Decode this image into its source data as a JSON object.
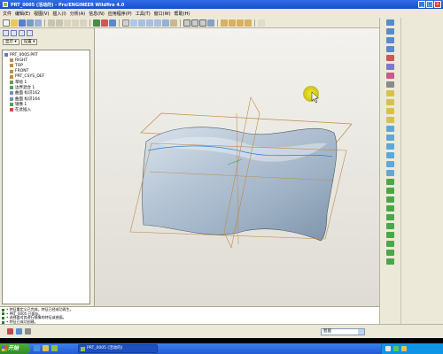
{
  "window": {
    "title": "PRT_0005 (活动的) - Pro/ENGINEER Wildfire 4.0",
    "buttons": [
      "_",
      "□",
      "×"
    ]
  },
  "menu": [
    "文件",
    "编辑(E)",
    "视图(V)",
    "插入(I)",
    "分析(A)",
    "信息(N)",
    "应用程序(P)",
    "工具(T)",
    "窗口(W)",
    "帮助(H)"
  ],
  "nav": {
    "tabs": [
      "显示",
      "设置"
    ],
    "tree": [
      {
        "label": "PRT_0005.PRT",
        "child": false
      },
      {
        "label": "RIGHT",
        "child": true
      },
      {
        "label": "TOP",
        "child": true
      },
      {
        "label": "FRONT",
        "child": true
      },
      {
        "label": "PRT_CSYS_DEF",
        "child": true
      },
      {
        "label": "草绘 1",
        "child": true
      },
      {
        "label": "边界混合 1",
        "child": true
      },
      {
        "label": "曲面 标识162",
        "child": true
      },
      {
        "label": "曲面 标识164",
        "child": true
      },
      {
        "label": "镜像 1",
        "child": true
      },
      {
        "label": "在此插入",
        "child": true
      }
    ]
  },
  "messages": [
    "•  特征重定义已完成，特征已经成功再生。",
    "•  PRT_0005 已保存。",
    "•  选择要对其进行镜像的特征或曲面。",
    "•  特征已成功创建。"
  ],
  "status": {
    "filter_value": "智能"
  },
  "taskbar": {
    "start_label": "开始",
    "task_label": "PRT_0005 (活动的)"
  },
  "colors": {
    "surface": "#b7c6d6",
    "datum": "#c08a4a",
    "cursor_highlight": "#d8cf1a",
    "titlebar": "#2f6ee8"
  }
}
